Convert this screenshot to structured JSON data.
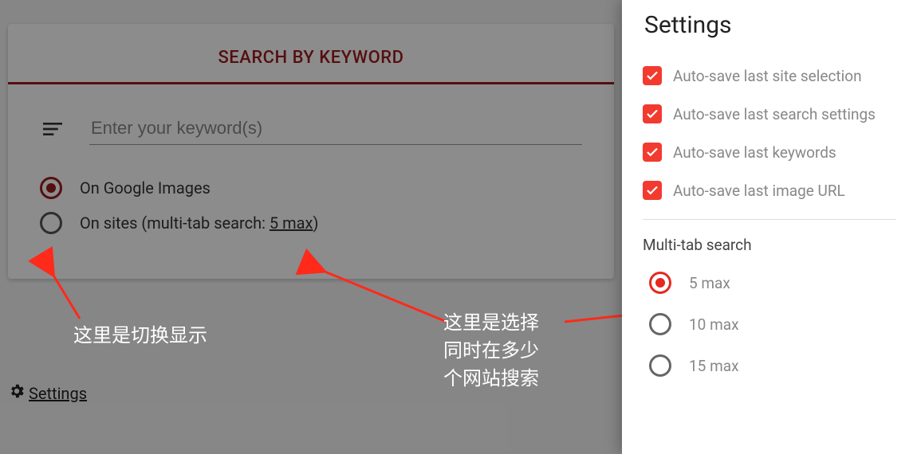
{
  "main": {
    "tab_title": "SEARCH BY KEYWORD",
    "keyword_placeholder": "Enter your keyword(s)",
    "option_google": "On Google Images",
    "option_sites_prefix": "On sites (multi-tab search: ",
    "option_sites_link": "5 max",
    "option_sites_suffix": ")",
    "settings_link": "Settings"
  },
  "panel": {
    "title": "Settings",
    "checks": [
      "Auto-save last site selection",
      "Auto-save last search settings",
      "Auto-save last keywords",
      "Auto-save last image URL"
    ],
    "section": "Multi-tab search",
    "radios": [
      "5 max",
      "10 max",
      "15 max"
    ],
    "radio_selected": 0
  },
  "annotations": {
    "left": "这里是切换显示",
    "right": "这里是选择\n同时在多少\n个网站搜索"
  }
}
